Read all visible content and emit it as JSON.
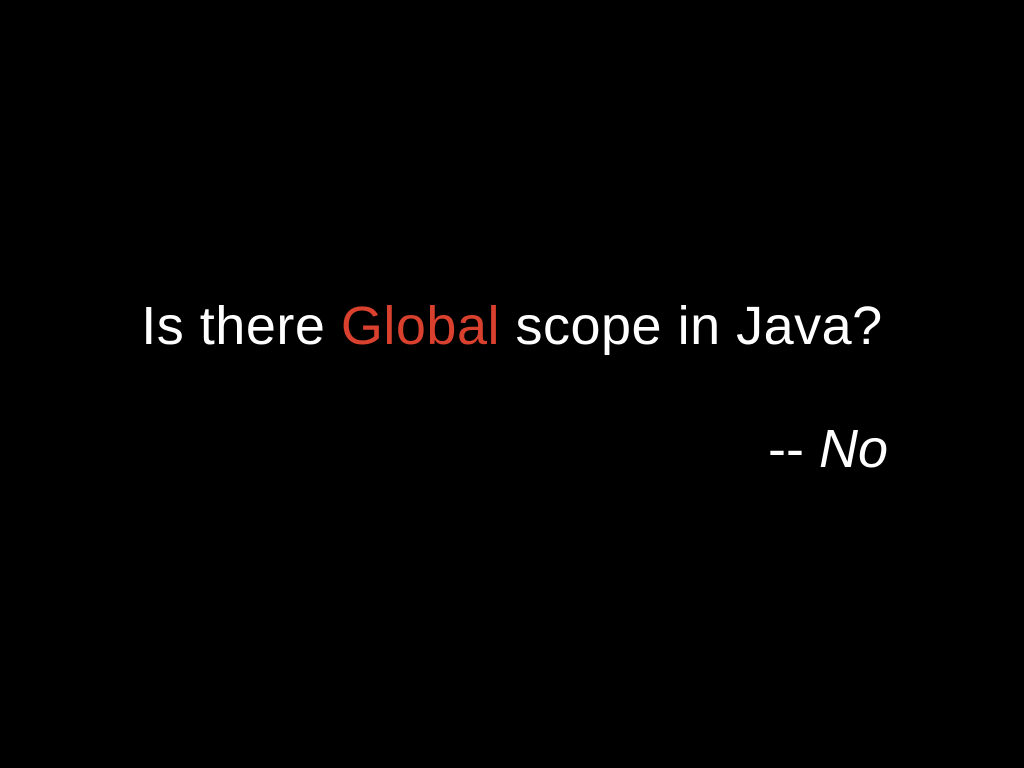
{
  "slide": {
    "question": {
      "before": "Is there ",
      "highlight": "Global",
      "after": " scope in Java?"
    },
    "answer": {
      "dash": "-- ",
      "word": "No"
    }
  },
  "colors": {
    "background": "#000000",
    "text": "#ffffff",
    "highlight": "#d9412e"
  }
}
